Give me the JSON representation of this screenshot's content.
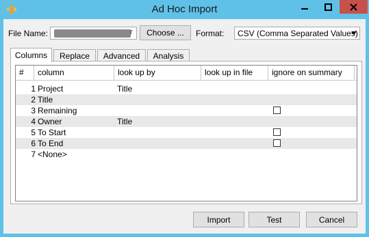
{
  "window": {
    "title": "Ad Hoc Import"
  },
  "file": {
    "label": "File Name:",
    "value_tail": "r",
    "choose_label": "Choose ..."
  },
  "format": {
    "label": "Format:",
    "selected": "CSV (Comma Separated Values)"
  },
  "tabs": [
    {
      "label": "Columns",
      "active": true
    },
    {
      "label": "Replace",
      "active": false
    },
    {
      "label": "Advanced",
      "active": false
    },
    {
      "label": "Analysis",
      "active": false
    }
  ],
  "grid": {
    "headers": [
      "#",
      "column",
      "look up by",
      "look up in file",
      "ignore on summary"
    ],
    "rows": [
      {
        "num": "1",
        "column": "Project",
        "look_up_by": "Title",
        "ignore_checkbox": false
      },
      {
        "num": "2",
        "column": "Title",
        "look_up_by": "",
        "ignore_checkbox": false
      },
      {
        "num": "3",
        "column": "Remaining",
        "look_up_by": "",
        "ignore_checkbox": true,
        "checked": false
      },
      {
        "num": "4",
        "column": "Owner",
        "look_up_by": "Title",
        "ignore_checkbox": false
      },
      {
        "num": "5",
        "column": "To Start",
        "look_up_by": "",
        "ignore_checkbox": true,
        "checked": false
      },
      {
        "num": "6",
        "column": "To End",
        "look_up_by": "",
        "ignore_checkbox": true,
        "checked": false
      },
      {
        "num": "7",
        "column": "<None>",
        "look_up_by": "",
        "ignore_checkbox": false
      }
    ]
  },
  "buttons": {
    "import": "Import",
    "test": "Test",
    "cancel": "Cancel"
  },
  "colors": {
    "frame": "#5fc1e8",
    "close": "#c7504a",
    "client": "#f0f0f0",
    "row_alt": "#e8e8e8"
  }
}
